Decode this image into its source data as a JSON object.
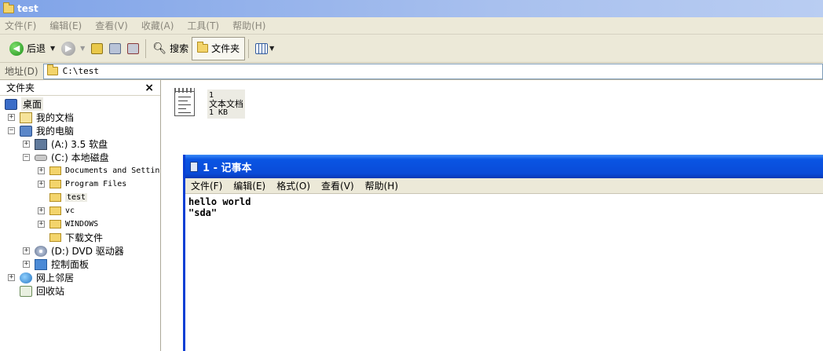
{
  "explorer": {
    "title": "test",
    "menu": [
      "文件(F)",
      "编辑(E)",
      "查看(V)",
      "收藏(A)",
      "工具(T)",
      "帮助(H)"
    ],
    "toolbar": {
      "back_label": "后退",
      "search_label": "搜索",
      "folders_label": "文件夹"
    },
    "address": {
      "label": "地址(D)",
      "value": "C:\\test"
    }
  },
  "folder_pane": {
    "title": "文件夹",
    "close": "×",
    "tree": [
      {
        "label": "桌面"
      },
      {
        "label": "我的文档"
      },
      {
        "label": "我的电脑"
      },
      {
        "label": "(A:) 3.5 软盘"
      },
      {
        "label": "(C:) 本地磁盘"
      },
      {
        "label": "Documents and Settin"
      },
      {
        "label": "Program Files"
      },
      {
        "label": "test"
      },
      {
        "label": "vc"
      },
      {
        "label": "WINDOWS"
      },
      {
        "label": "下载文件"
      },
      {
        "label": "(D:) DVD 驱动器"
      },
      {
        "label": "控制面板"
      },
      {
        "label": "网上邻居"
      },
      {
        "label": "回收站"
      }
    ]
  },
  "file": {
    "name": "1",
    "type": "文本文档",
    "size": "1 KB"
  },
  "notepad": {
    "title": "1 - 记事本",
    "menu": [
      "文件(F)",
      "编辑(E)",
      "格式(O)",
      "查看(V)",
      "帮助(H)"
    ],
    "content": "hello world\n\"sda\""
  },
  "colors": {
    "xp_blue": "#0a4bd8",
    "menu_bg": "#ece9d8"
  }
}
